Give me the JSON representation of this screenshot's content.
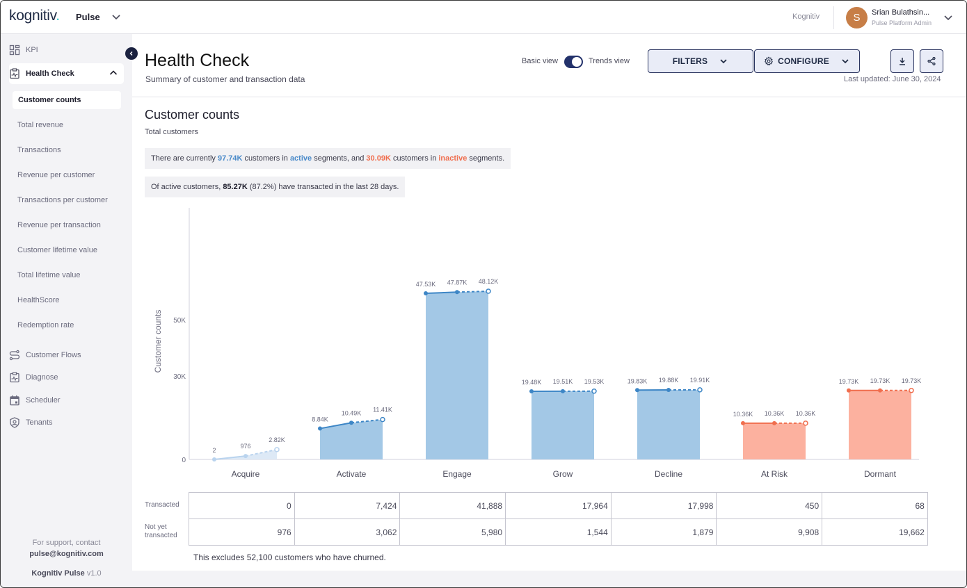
{
  "topbar": {
    "logo": "kognitiv",
    "app_name": "Pulse",
    "tenant": "Kognitiv",
    "user_initial": "S",
    "user_name": "Srian Bulathsin...",
    "user_role": "Pulse Platform Admin"
  },
  "sidebar": {
    "items": [
      {
        "label": "KPI",
        "icon": "grid-icon"
      },
      {
        "label": "Health Check",
        "icon": "health-clipboard-icon",
        "expanded": true
      },
      {
        "label": "Customer Flows",
        "icon": "flow-icon"
      },
      {
        "label": "Diagnose",
        "icon": "diagnose-icon"
      },
      {
        "label": "Scheduler",
        "icon": "calendar-icon"
      },
      {
        "label": "Tenants",
        "icon": "shield-user-icon"
      }
    ],
    "sub_items": [
      {
        "label": "Customer counts",
        "active": true
      },
      {
        "label": "Total revenue"
      },
      {
        "label": "Transactions"
      },
      {
        "label": "Revenue per customer"
      },
      {
        "label": "Transactions per customer"
      },
      {
        "label": "Revenue per transaction"
      },
      {
        "label": "Customer lifetime value"
      },
      {
        "label": "Total lifetime value"
      },
      {
        "label": "HealthScore"
      },
      {
        "label": "Redemption rate"
      }
    ],
    "support_text": "For support, contact",
    "support_email": "pulse@kognitiv.com",
    "product_name": "Kognitiv Pulse",
    "version": "v1.0"
  },
  "header": {
    "title": "Health Check",
    "subtitle": "Summary of customer and transaction data",
    "basic_view_label": "Basic view",
    "trends_view_label": "Trends view",
    "trends_view_on": true,
    "filters_label": "FILTERS",
    "configure_label": "CONFIGURE",
    "last_updated": "Last updated: June 30, 2024"
  },
  "section": {
    "title": "Customer counts",
    "subtitle": "Total customers",
    "callout1": {
      "pre": "There are currently ",
      "active_count": "97.74K",
      "mid1": " customers in ",
      "active_word": "active",
      "mid2": " segments, and ",
      "inactive_count": "30.09K",
      "mid3": " customers in ",
      "inactive_word": "inactive",
      "post": " segments."
    },
    "callout2": {
      "pre": "Of active customers, ",
      "count": "85.27K",
      "post": " (87.2%) have transacted in the last 28 days."
    }
  },
  "colors": {
    "active_bar": "#a3c8e6",
    "active_line": "#3d86c6",
    "acquire_bar": "#dde9f6",
    "acquire_line": "#b9d3ee",
    "inactive_bar": "#fcb19f",
    "inactive_line": "#f06e4e"
  },
  "chart_data": {
    "type": "bar",
    "title": "",
    "xlabel": "",
    "ylabel": "Customer counts",
    "yticks": [
      "0",
      "30K",
      "50K"
    ],
    "categories": [
      "Acquire",
      "Activate",
      "Engage",
      "Grow",
      "Decline",
      "At Risk",
      "Dormant"
    ],
    "status": [
      "acquire",
      "active",
      "active",
      "active",
      "active",
      "inactive",
      "inactive"
    ],
    "trend_points": [
      {
        "values": [
          2,
          976,
          2820
        ],
        "labels": [
          "2",
          "976",
          "2.82K"
        ]
      },
      {
        "values": [
          8840,
          10490,
          11410
        ],
        "labels": [
          "8.84K",
          "10.49K",
          "11.41K"
        ]
      },
      {
        "values": [
          47530,
          47870,
          48120
        ],
        "labels": [
          "47.53K",
          "47.87K",
          "48.12K"
        ]
      },
      {
        "values": [
          19480,
          19510,
          19530
        ],
        "labels": [
          "19.48K",
          "19.51K",
          "19.53K"
        ]
      },
      {
        "values": [
          19830,
          19880,
          19910
        ],
        "labels": [
          "19.83K",
          "19.88K",
          "19.91K"
        ]
      },
      {
        "values": [
          10360,
          10360,
          10360
        ],
        "labels": [
          "10.36K",
          "10.36K",
          "10.36K"
        ]
      },
      {
        "values": [
          19730,
          19730,
          19730
        ],
        "labels": [
          "19.73K",
          "19.73K",
          "19.73K"
        ]
      }
    ],
    "grid": false,
    "legend": "none"
  },
  "table": {
    "row_labels": [
      "Transacted",
      "Not yet transacted"
    ],
    "rows": [
      [
        "0",
        "7,424",
        "41,888",
        "17,964",
        "17,998",
        "450",
        "68"
      ],
      [
        "976",
        "3,062",
        "5,980",
        "1,544",
        "1,879",
        "9,908",
        "19,662"
      ]
    ],
    "footnote": "This excludes 52,100 customers who have churned."
  }
}
